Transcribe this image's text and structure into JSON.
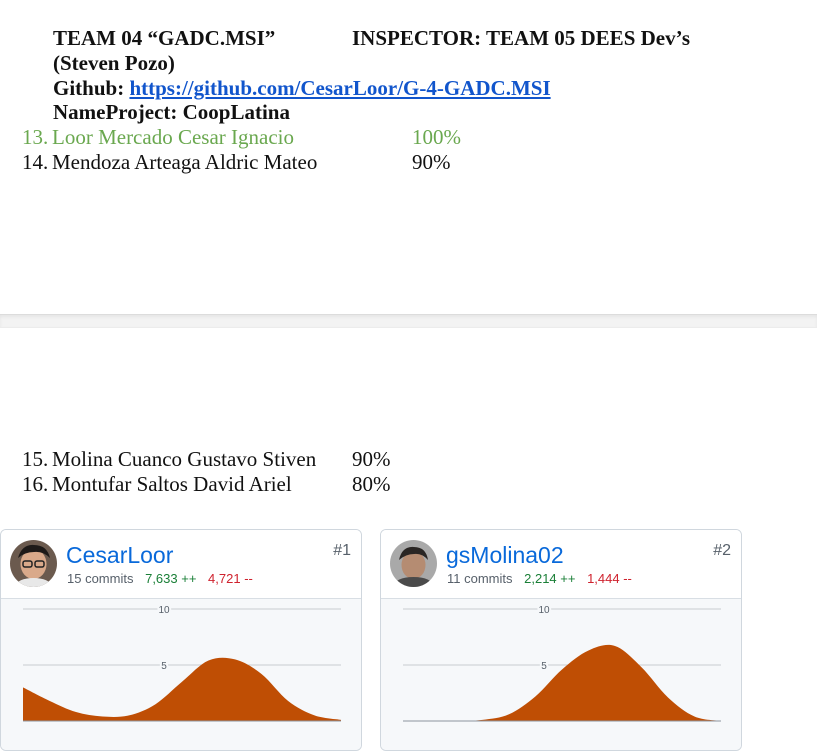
{
  "header": {
    "team": "TEAM 04 “GADC.MSI”",
    "inspector": "INSPECTOR: TEAM 05 DEES Dev’s",
    "member": "(Steven Pozo)",
    "github_label": "Github:",
    "github_url": "https://github.com/CesarLoor/G-4-GADC.MSI",
    "project": "NameProject: CoopLatina"
  },
  "members_page1": [
    {
      "num": "13.",
      "name": "Loor Mercado Cesar Ignacio",
      "pct": "100%",
      "color": "#6aa84f"
    },
    {
      "num": "14.",
      "name": "Mendoza Arteaga Aldric Mateo",
      "pct": "90%",
      "color": "#111111"
    }
  ],
  "members_page2": [
    {
      "num": "15.",
      "name": "Molina Cuanco Gustavo Stiven",
      "pct": "90%"
    },
    {
      "num": "16.",
      "name": "Montufar Saltos David Ariel",
      "pct": "80%"
    }
  ],
  "contributors": [
    {
      "user": "CesarLoor",
      "rank": "#1",
      "commits": "15 commits",
      "additions": "7,633 ++",
      "deletions": "4,721 --",
      "chart": {
        "yticks": [
          "10",
          "5"
        ],
        "ymax": 10,
        "values": [
          3,
          1.8,
          0.8,
          0.4,
          0.5,
          1.5,
          3.5,
          5.4,
          5.5,
          4.2,
          1.8,
          0.5,
          0.1
        ]
      }
    },
    {
      "user": "gsMolina02",
      "rank": "#2",
      "commits": "11 commits",
      "additions": "2,214 ++",
      "deletions": "1,444 --",
      "chart": {
        "yticks": [
          "10",
          "5"
        ],
        "ymax": 10,
        "values": [
          0,
          0,
          0,
          0.1,
          0.6,
          2.2,
          4.6,
          6.3,
          6.7,
          4.8,
          2.1,
          0.4,
          0
        ]
      }
    }
  ],
  "colors": {
    "area": "#bf4e04",
    "link": "#1155cc",
    "accent_green": "#6aa84f"
  }
}
